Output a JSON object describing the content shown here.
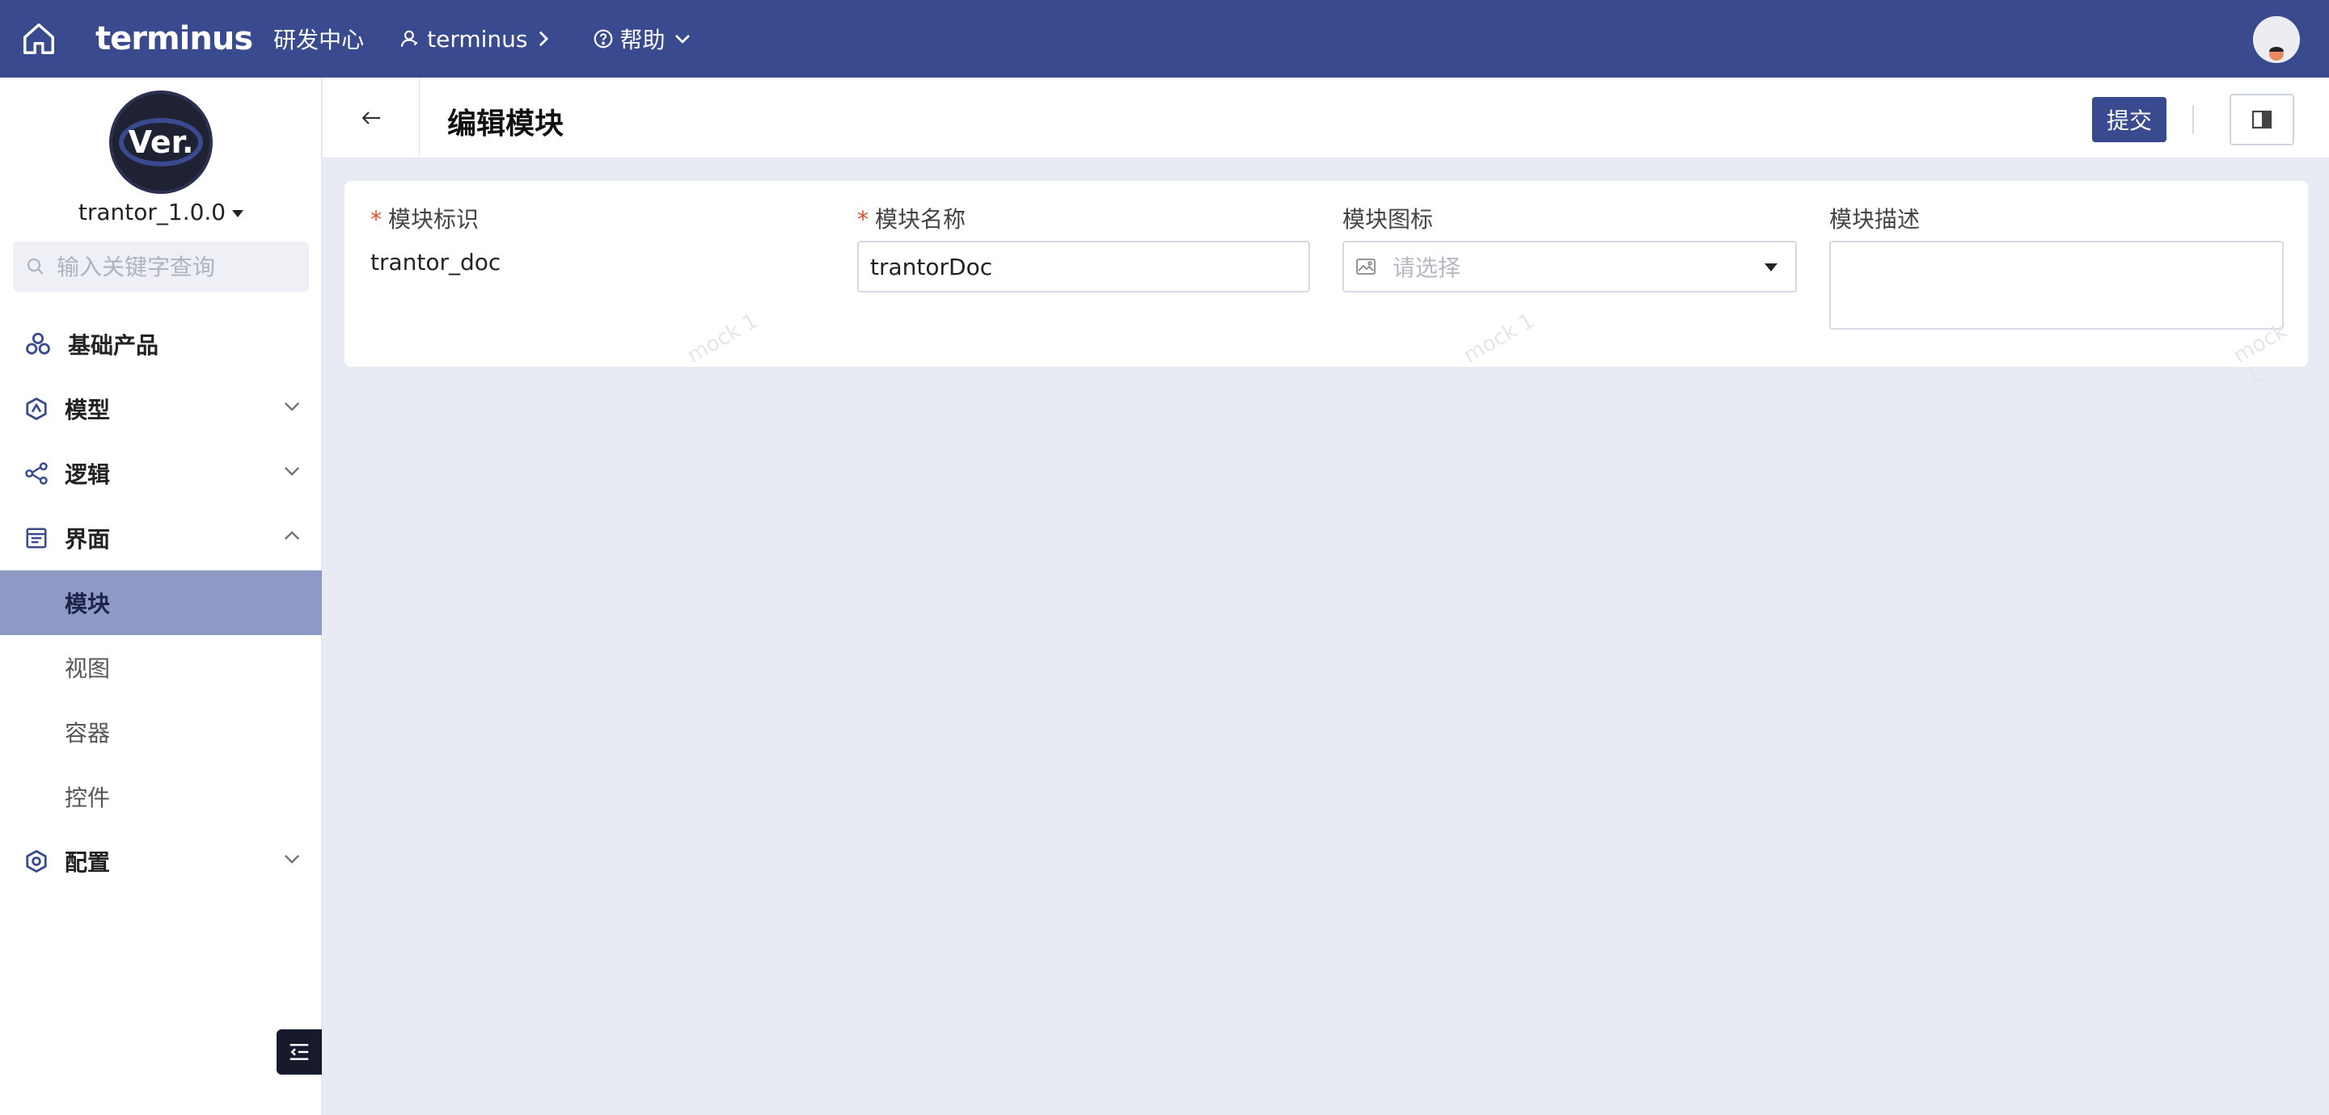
{
  "topbar": {
    "logo": "terminus",
    "center": "研发中心",
    "tenant": "terminus",
    "help": "帮助"
  },
  "sidebar": {
    "logo_text": "Ver.",
    "version": "trantor_1.0.0",
    "search_placeholder": "输入关键字查询",
    "nav": {
      "base": "基础产品",
      "model": "模型",
      "logic": "逻辑",
      "ui": "界面",
      "ui_children": [
        "模块",
        "视图",
        "容器",
        "控件"
      ],
      "config": "配置"
    }
  },
  "header": {
    "title": "编辑模块",
    "submit_label": "提交"
  },
  "form": {
    "key_label": "模块标识",
    "key_value": "trantor_doc",
    "name_label": "模块名称",
    "name_value": "trantorDoc",
    "icon_label": "模块图标",
    "icon_placeholder": "请选择",
    "desc_label": "模块描述",
    "required_mark": "*",
    "watermark": "mock 1"
  },
  "colors": {
    "brand": "#3a4a8f",
    "active_nav_bg": "#8e99c6",
    "required": "#e04a2f",
    "page_bg": "#e8ebf3"
  }
}
